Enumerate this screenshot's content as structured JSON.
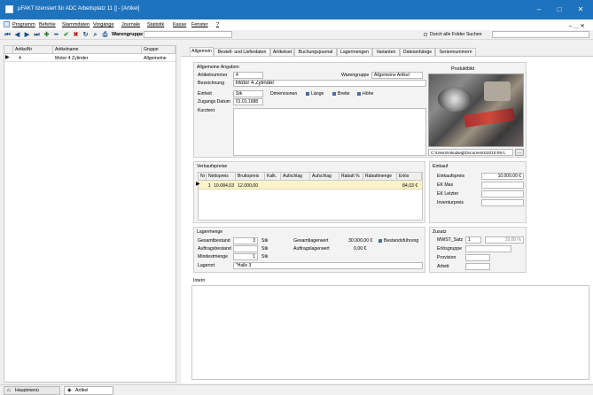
{
  "window": {
    "title": "µFAKT lizensiert für ADC   Arbeitsplatz 11 []     - [Artikel]",
    "minimize": "–",
    "maximize": "□",
    "close": "✕",
    "sub_controls": "– ＿ ✕"
  },
  "menu": [
    "Programm",
    "Befehle",
    "Stammdaten",
    "Vorgänge",
    "Journale",
    "Statistik",
    "Kasse",
    "Fenster",
    "?"
  ],
  "toolbar": {
    "group_label": "Warengruppe",
    "all_folders_label": "Durch alle Folder Suchen"
  },
  "list": {
    "columns": [
      "ArtikelNr",
      "Artikelname",
      "Gruppe"
    ],
    "rows": [
      {
        "nr": "4",
        "name": "Motor 4 Zylinder",
        "group": "Allgemeine"
      }
    ]
  },
  "tabs": [
    "Allgemein",
    "Bestell- und Lieferdaten",
    "Artikelset",
    "Buchungsjournal",
    "Lagermengen",
    "Varianten",
    "Dateianhänge",
    "Seriennummern"
  ],
  "general": {
    "title": "Allgemeine Angaben",
    "artnr_label": "Artikelnummer",
    "artnr_value": "4",
    "group_label": "Warengruppe",
    "group_value": "Allgemeine Artikel",
    "desc_label": "Bezeichnung",
    "desc_value": "Motor 4 Zylinder",
    "unit_label": "Einheit",
    "unit_value": "Stk",
    "dims_label": "Dimensionen",
    "dim1": "Länge",
    "dim2": "Breite",
    "dim3": "Höhe",
    "date_label": "Zugangs Datum",
    "date_value": "01.01.1988",
    "short_label": "Kurztext",
    "image_label": "Produktbild",
    "image_path": "C:\\Users\\mkudwig\\Documents\\2010-09-1"
  },
  "prices": {
    "title": "Verkaufspreise",
    "columns": [
      "Nr",
      "Nettopreis",
      "Bruttopreis",
      "Kalk.",
      "Aufschlag",
      "Aufschlag",
      "Rabatt %",
      "Rabattmenge",
      "Erlös"
    ],
    "row": {
      "nr": "1",
      "net": "10.084,03",
      "gross": "12.000,00",
      "revenue": "84,03 €"
    }
  },
  "purchase": {
    "title": "Einkauf",
    "price_label": "Einkaufspreis",
    "price_value": "10.000,00 €",
    "ek_max": "EK Max",
    "ek_last": "EK Letzter",
    "inventory": "Inventurpreis"
  },
  "stock": {
    "title": "Lagermenge",
    "total_label": "Gesamtbestand",
    "total_value": "3",
    "total_unit": "Stk",
    "orders_label": "Auftragsbestand",
    "orders_unit": "Stk",
    "min_label": "Mindestmenge",
    "min_value": "1",
    "min_unit": "Stk",
    "loc_label": "Lagerort",
    "loc_value": "\"Halle 3",
    "value_label": "Gesamtlagerwert",
    "value_value": "30.000,00 €",
    "ovalue_label": "Auftragslagerwert",
    "ovalue_value": "0,00 €",
    "tracking_label": "Bestandsführung"
  },
  "extra": {
    "title": "Zusatz",
    "vat_label": "MWST_Satz",
    "vat_value": "1",
    "vat_pct": "19,00 %",
    "revgroup_label": "Erlösgruppe",
    "commission_label": "Provision",
    "work_label": "Arbeit"
  },
  "intern": {
    "label": "Intern"
  },
  "bottom_tabs": [
    "Hauptmenü",
    "Artikel"
  ],
  "colors": {
    "titlebar": "#1e73be",
    "highlight_row": "#fdf3c8",
    "accent": "#4a6ca0"
  }
}
